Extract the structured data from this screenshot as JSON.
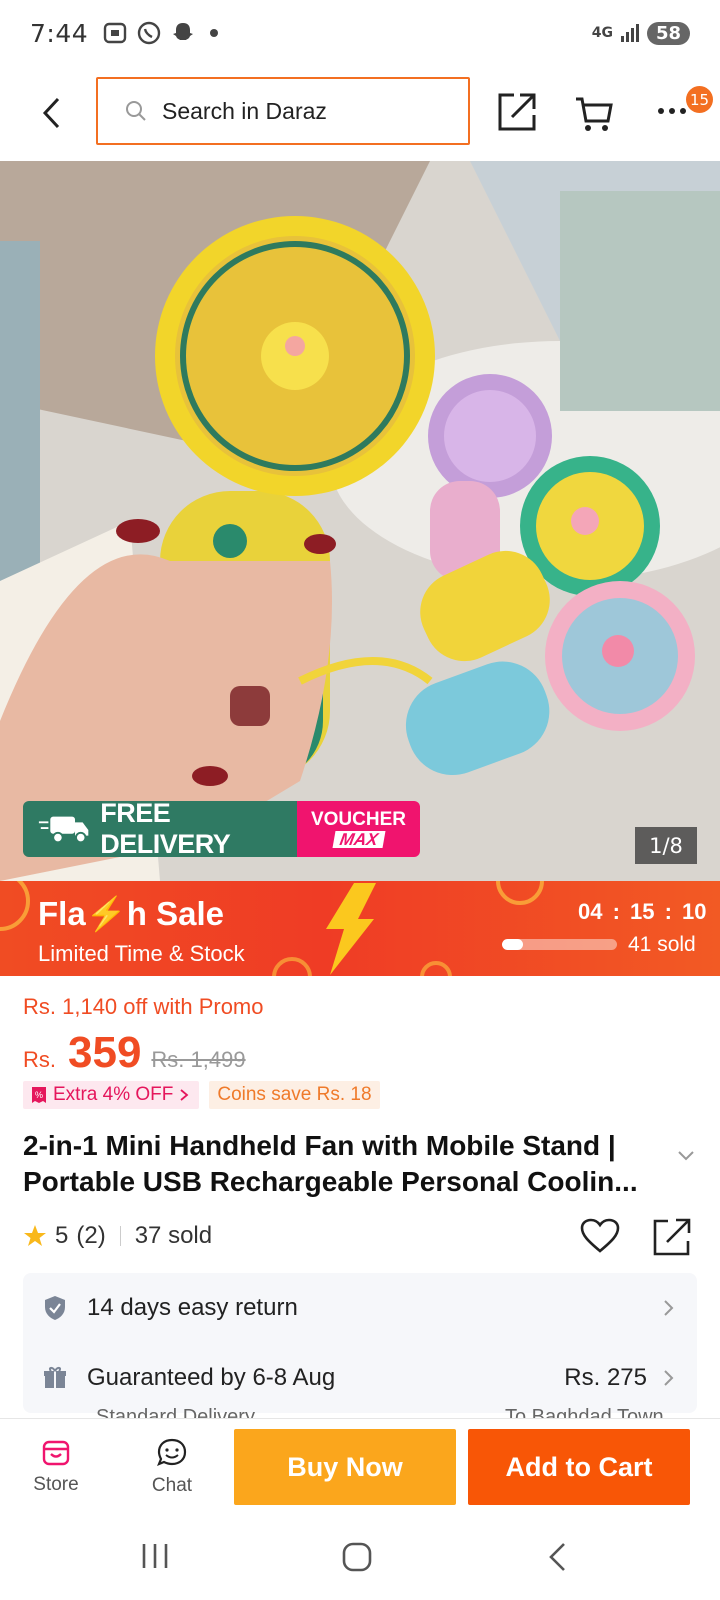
{
  "status_bar": {
    "time": "7:44",
    "network": "4G",
    "battery": "58"
  },
  "header": {
    "search_placeholder": "Search in Daraz",
    "more_badge": "15"
  },
  "gallery": {
    "free_delivery": "FREE DELIVERY",
    "voucher_top": "VOUCHER",
    "voucher_bottom": "MAX",
    "pager": "1/8"
  },
  "flash_sale": {
    "title": "Fla⚡h  Sale",
    "subtitle": "Limited Time & Stock",
    "timer": "04 : 15 : 10",
    "sold": "41 sold",
    "progress": 0.18
  },
  "price": {
    "promo": "Rs. 1,140 off with Promo",
    "currency": "Rs.",
    "value": "359",
    "original": "Rs. 1,499",
    "extra_off": "Extra 4% OFF",
    "coins": "Coins save Rs. 18"
  },
  "product": {
    "title": "2-in-1 Mini Handheld Fan with Mobile Stand | Portable USB Rechargeable Personal Coolin...",
    "rating": "5",
    "reviews": "(2)",
    "sold": "37 sold"
  },
  "service": {
    "return": "14 days easy return",
    "delivery": "Guaranteed by 6-8 Aug",
    "delivery_price": "Rs. 275",
    "delivery_type": "Standard Delivery",
    "delivery_to": "To Baghdad Town"
  },
  "actions": {
    "store": "Store",
    "chat": "Chat",
    "buy_now": "Buy Now",
    "add_to_cart": "Add to Cart"
  },
  "colors": {
    "accent": "#f85606",
    "promo": "#f04c23",
    "buy_now": "#fba61c",
    "free_delivery": "#2f7a63",
    "voucher": "#f0146e"
  }
}
